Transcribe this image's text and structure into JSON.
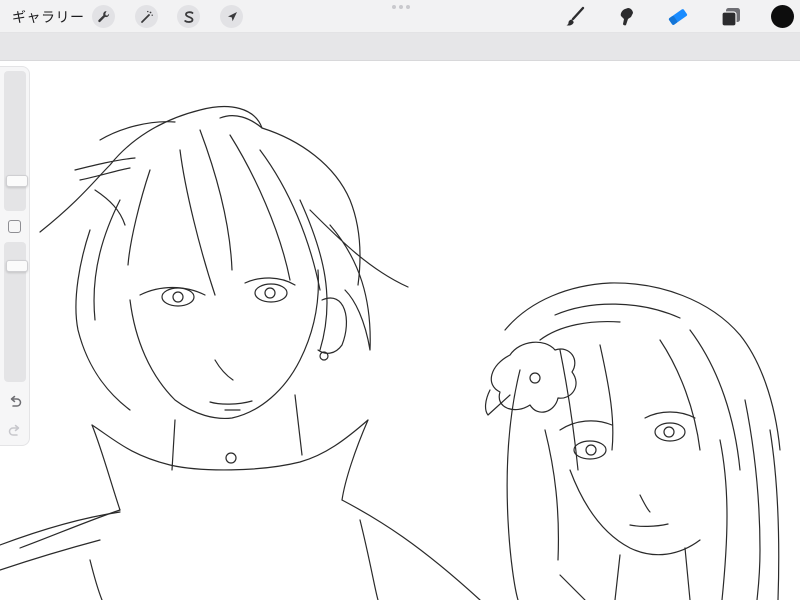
{
  "app": {
    "gallery_label": "ギャラリー"
  },
  "top_left_tools": [
    {
      "icon": "wrench-icon",
      "name": "actions"
    },
    {
      "icon": "magic-wand-icon",
      "name": "adjustments"
    },
    {
      "icon": "selection-s-icon",
      "name": "selection"
    },
    {
      "icon": "arrow-cursor-icon",
      "name": "transform"
    }
  ],
  "top_right_tools": [
    {
      "icon": "brush-icon",
      "name": "paint",
      "active": false
    },
    {
      "icon": "smudge-icon",
      "name": "smudge",
      "active": false
    },
    {
      "icon": "eraser-icon",
      "name": "erase",
      "active": true
    },
    {
      "icon": "layers-icon",
      "name": "layers",
      "active": false
    }
  ],
  "current_color": "#0d0d0d",
  "accent_color": "#1a8cff",
  "sidebar": {
    "brush_size_level": 0.82,
    "opacity_level": 0.05
  },
  "canvas": {
    "content": "pencil-sketch"
  }
}
